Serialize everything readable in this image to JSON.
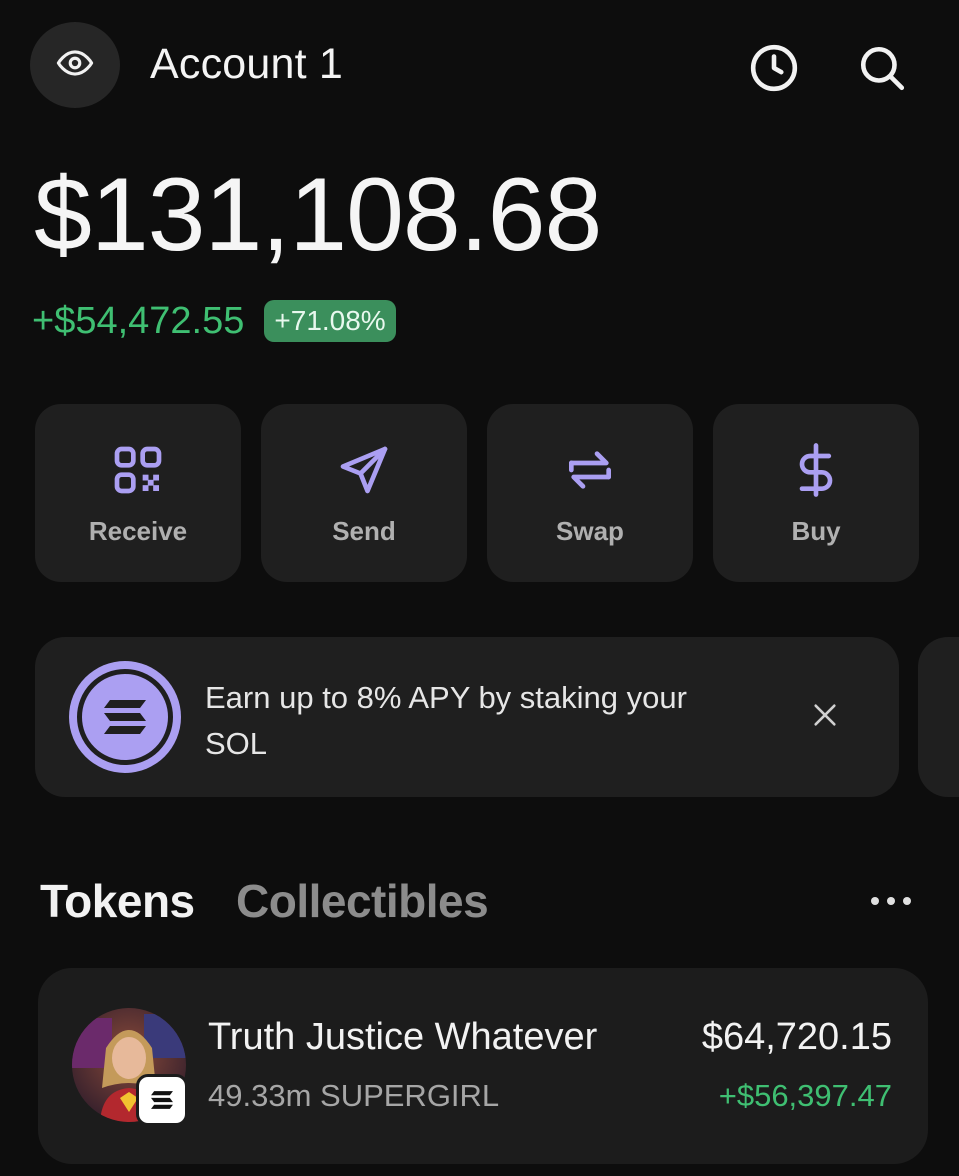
{
  "header": {
    "title": "Account 1",
    "eye_icon": "eye-icon",
    "history_icon": "clock-icon",
    "search_icon": "search-icon"
  },
  "balance": {
    "total": "$131,108.68",
    "change_amount": "+$54,472.55",
    "change_percent": "+71.08%"
  },
  "actions": [
    {
      "label": "Receive",
      "icon": "qr-code-icon"
    },
    {
      "label": "Send",
      "icon": "send-icon"
    },
    {
      "label": "Swap",
      "icon": "swap-icon"
    },
    {
      "label": "Buy",
      "icon": "dollar-icon"
    }
  ],
  "promo": {
    "text": "Earn up to 8% APY by staking your SOL",
    "icon": "solana-icon"
  },
  "tabs": {
    "tokens": "Tokens",
    "collectibles": "Collectibles",
    "active": "Tokens"
  },
  "tokens": [
    {
      "name": "Truth Justice Whatever",
      "amount": "49.33m SUPERGIRL",
      "value": "$64,720.15",
      "change": "+$56,397.47"
    }
  ],
  "colors": {
    "accent": "#ab9ff2",
    "positive": "#3fbf72",
    "card": "#1f1f1f",
    "background": "#0d0d0d"
  }
}
